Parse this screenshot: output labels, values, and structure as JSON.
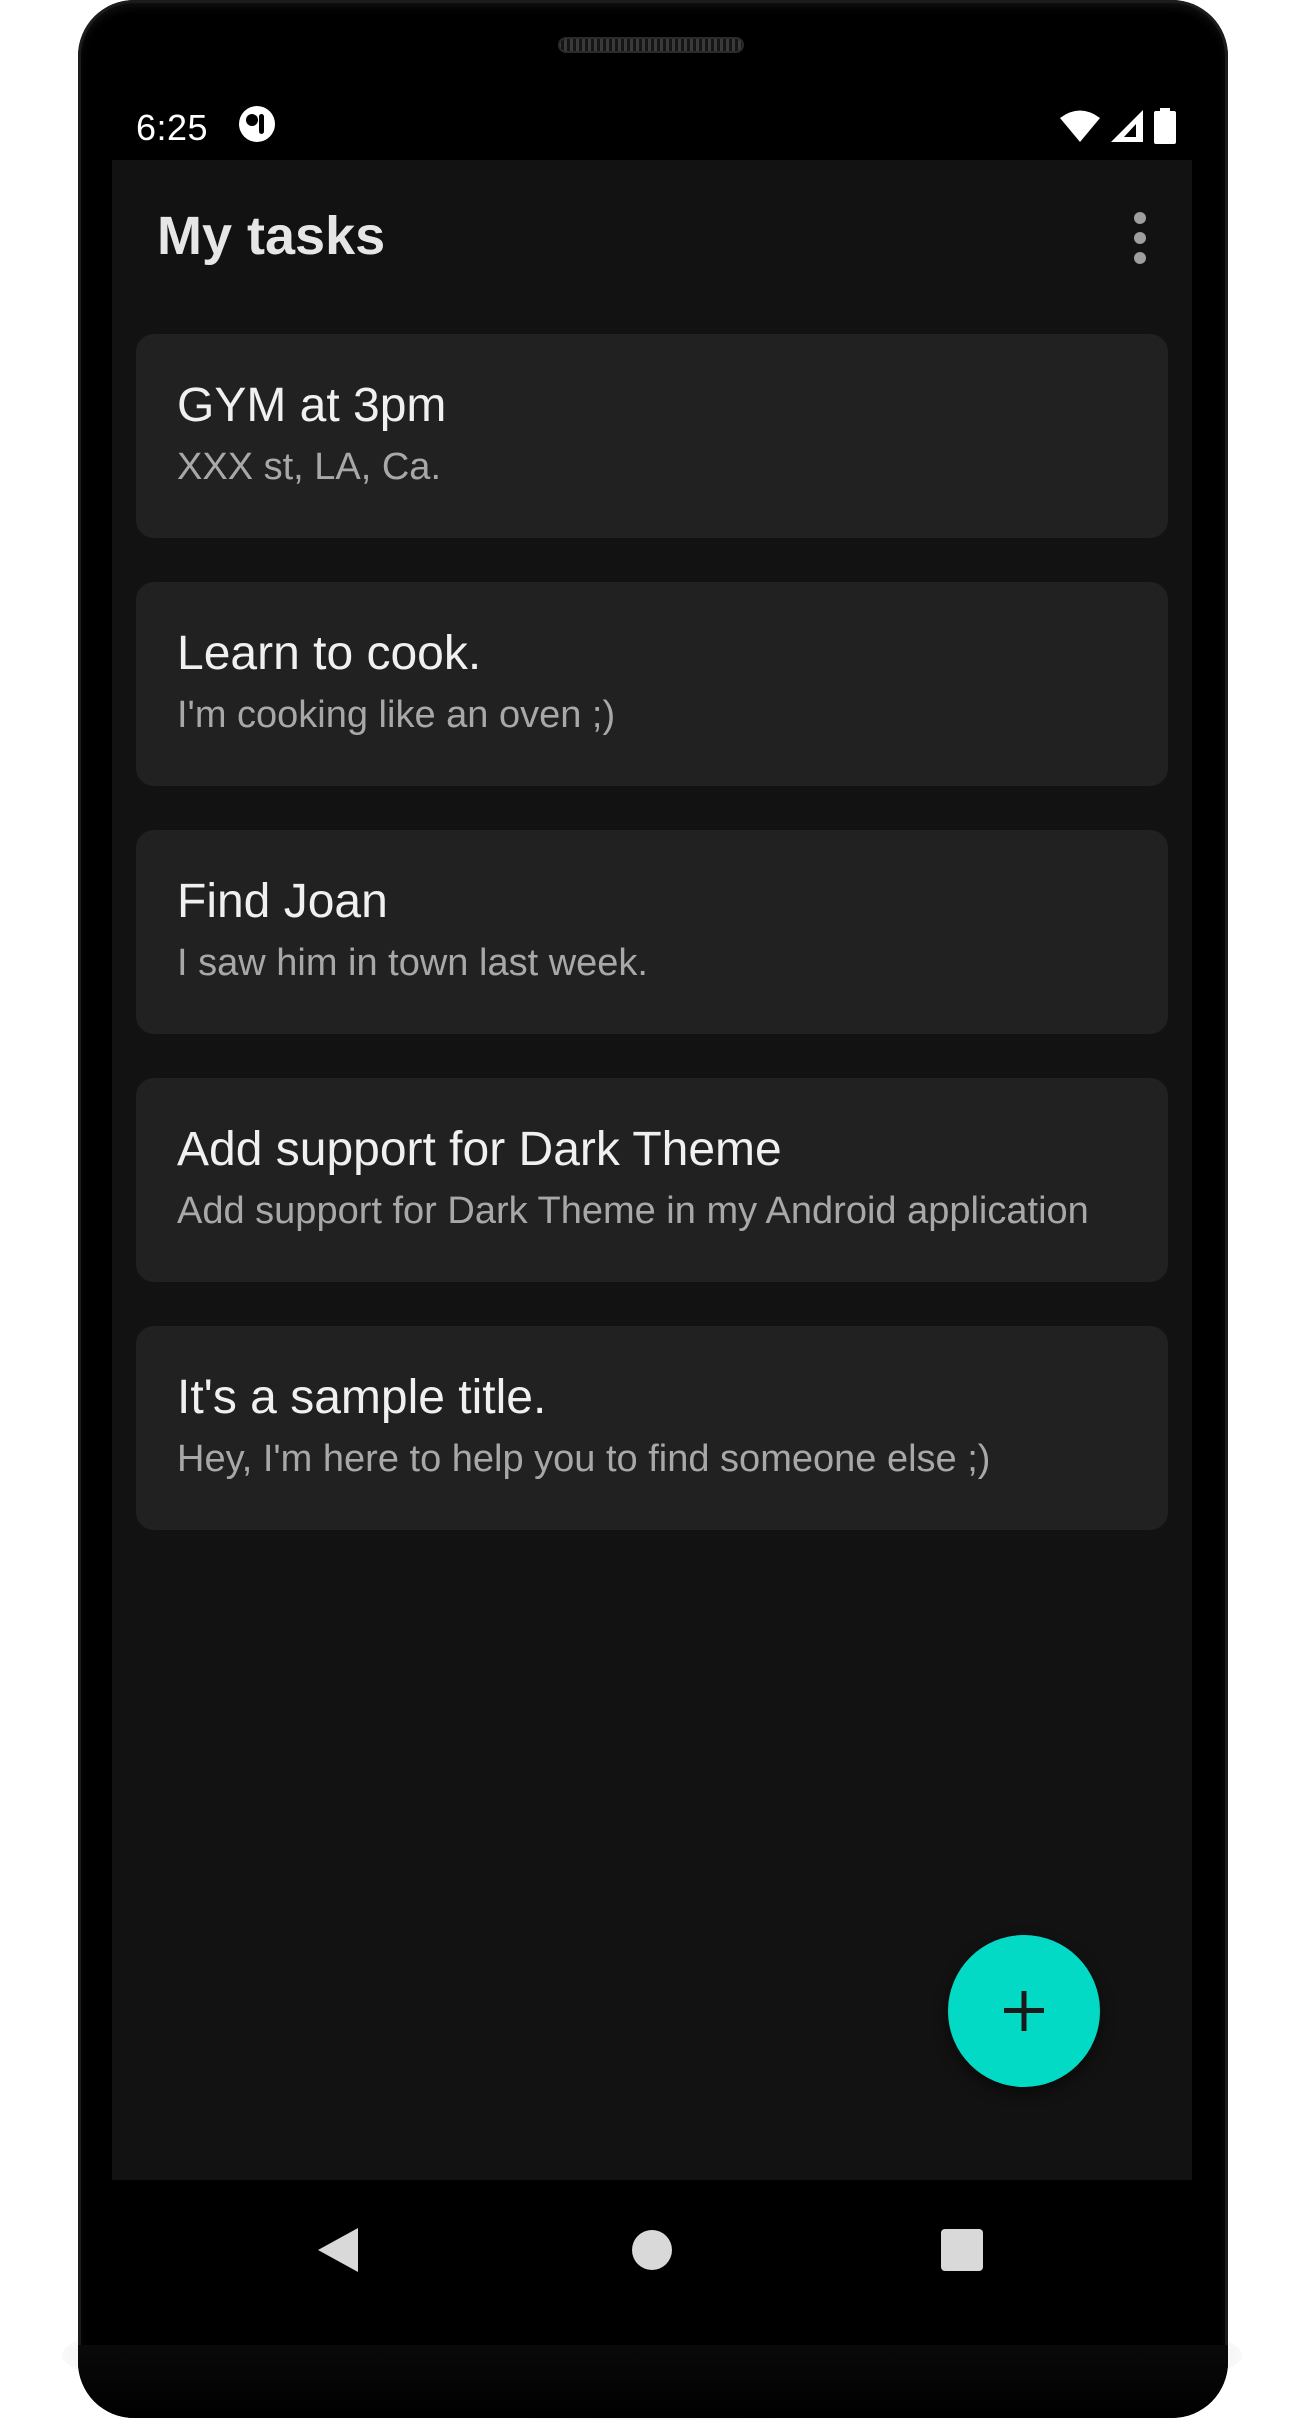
{
  "status_bar": {
    "time": "6:25",
    "app_icon": "circle-app-icon",
    "icons": [
      "wifi-icon",
      "cell-signal-icon",
      "battery-icon"
    ]
  },
  "app_bar": {
    "title": "My tasks",
    "menu_icon": "more-vert-icon"
  },
  "tasks": [
    {
      "title": "GYM at 3pm",
      "subtitle": "XXX st, LA, Ca."
    },
    {
      "title": "Learn to cook.",
      "subtitle": "I'm cooking like an oven ;)"
    },
    {
      "title": "Find Joan",
      "subtitle": "I saw him in town last week."
    },
    {
      "title": "Add support for Dark Theme",
      "subtitle": "Add support for Dark Theme in my Android application"
    },
    {
      "title": "It's a sample title.",
      "subtitle": "Hey, I'm here to help you to find someone else ;)"
    }
  ],
  "fab": {
    "icon": "plus-icon"
  },
  "nav_bar": {
    "buttons": [
      "back-icon",
      "home-icon",
      "recents-icon"
    ]
  },
  "colors": {
    "background": "#121212",
    "card": "#212121",
    "accent": "#03dac5",
    "title_text": "#e6e6e6",
    "secondary_text": "#a8a8a8"
  }
}
